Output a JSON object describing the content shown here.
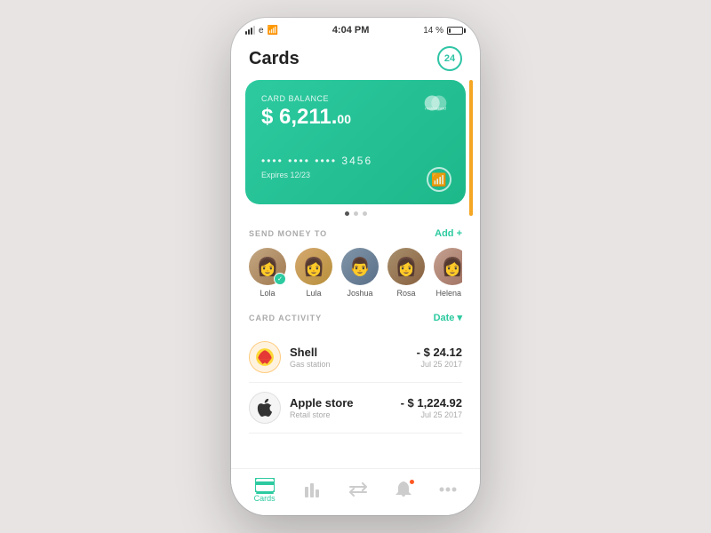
{
  "status_bar": {
    "time": "4:04 PM",
    "battery_percent": "14 %",
    "carrier": "e"
  },
  "header": {
    "title": "Cards",
    "badge_count": "24"
  },
  "card": {
    "label": "Card balance",
    "balance": "$ 6,211.",
    "cents": "00",
    "number": "••••  ••••  ••••  3456",
    "expires": "Expires 12/23",
    "brand": "mastercard"
  },
  "send_money": {
    "section_title": "SEND MONEY TO",
    "add_label": "Add +",
    "contacts": [
      {
        "name": "Lola",
        "has_check": true
      },
      {
        "name": "Lula",
        "has_check": false
      },
      {
        "name": "Joshua",
        "has_check": false
      },
      {
        "name": "Rosa",
        "has_check": false
      },
      {
        "name": "Helena V",
        "has_check": false
      }
    ]
  },
  "activity": {
    "section_title": "CARD ACTIVITY",
    "filter_label": "Date ▾",
    "transactions": [
      {
        "name": "Shell",
        "type": "Gas station",
        "amount": "- $ 24.12",
        "date": "Jul 25 2017",
        "icon_type": "shell"
      },
      {
        "name": "Apple store",
        "type": "Retail store",
        "amount": "- $ 1,224.92",
        "date": "Jul 25 2017",
        "icon_type": "apple"
      }
    ]
  },
  "nav": {
    "items": [
      {
        "label": "Cards",
        "icon": "card",
        "active": true
      },
      {
        "label": "",
        "icon": "chart",
        "active": false
      },
      {
        "label": "",
        "icon": "transfer",
        "active": false
      },
      {
        "label": "",
        "icon": "bell",
        "active": false,
        "notif": true
      },
      {
        "label": "",
        "icon": "more",
        "active": false
      }
    ]
  }
}
